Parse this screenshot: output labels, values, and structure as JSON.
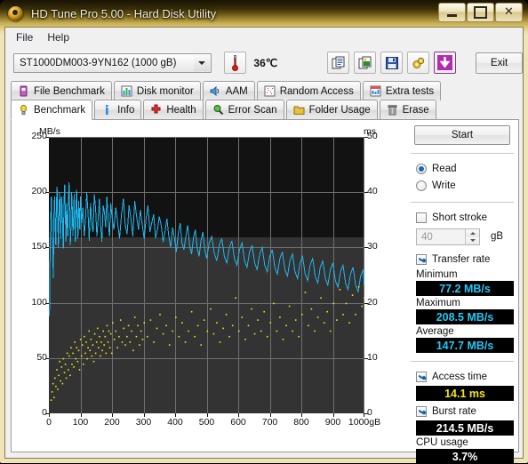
{
  "window": {
    "title": "HD Tune Pro 5.00 - Hard Disk Utility",
    "minimize_label": "",
    "maximize_label": "",
    "close_label": "✕"
  },
  "menu": {
    "items": [
      "File",
      "Help"
    ]
  },
  "toolbar": {
    "drive": "ST1000DM003-9YN162 (1000 gB)",
    "temperature": "36℃",
    "exit_label": "Exit",
    "icons": [
      "copy-text-icon",
      "copy-image-icon",
      "save-icon",
      "settings-icon",
      "download-icon"
    ]
  },
  "tabs": {
    "top_row": [
      {
        "label": "File Benchmark",
        "icon": "file-benchmark-icon"
      },
      {
        "label": "Disk monitor",
        "icon": "disk-monitor-icon"
      },
      {
        "label": "AAM",
        "icon": "aam-speaker-icon"
      },
      {
        "label": "Random Access",
        "icon": "random-access-icon"
      },
      {
        "label": "Extra tests",
        "icon": "extra-tests-icon"
      }
    ],
    "bottom_row": [
      {
        "label": "Benchmark",
        "icon": "benchmark-bulb-icon",
        "selected": true
      },
      {
        "label": "Info",
        "icon": "info-icon",
        "selected": false
      },
      {
        "label": "Health",
        "icon": "health-cross-icon",
        "selected": false
      },
      {
        "label": "Error Scan",
        "icon": "error-scan-magnifier-icon",
        "selected": false
      },
      {
        "label": "Folder Usage",
        "icon": "folder-usage-icon",
        "selected": false
      },
      {
        "label": "Erase",
        "icon": "erase-trash-icon",
        "selected": false
      }
    ]
  },
  "controls": {
    "start_label": "Start",
    "read_label": "Read",
    "read_selected": true,
    "write_label": "Write",
    "write_selected": false,
    "short_stroke_label": "Short stroke",
    "short_stroke_checked": false,
    "short_stroke_value": "40",
    "short_stroke_unit": "gB",
    "transfer_rate_label": "Transfer rate",
    "transfer_rate_checked": true,
    "access_time_label": "Access time",
    "access_time_checked": true,
    "burst_rate_label": "Burst rate",
    "burst_rate_checked": true
  },
  "results": {
    "minimum_label": "Minimum",
    "minimum_value": "77.2 MB/s",
    "maximum_label": "Maximum",
    "maximum_value": "208.5 MB/s",
    "average_label": "Average",
    "average_value": "147.7 MB/s",
    "access_time_value": "14.1 ms",
    "burst_rate_value": "214.5 MB/s",
    "cpu_usage_label": "CPU usage",
    "cpu_usage_value": "3.7%"
  },
  "chart_data": {
    "type": "line",
    "title": "",
    "xlabel": "gB",
    "ylabel": "MB/s",
    "y2label": "ms",
    "xlim": [
      0,
      1000
    ],
    "ylim": [
      0,
      250
    ],
    "y2lim": [
      0,
      50
    ],
    "xticks": [
      0,
      100,
      200,
      300,
      400,
      500,
      600,
      700,
      800,
      900,
      1000
    ],
    "xtick_labels": [
      "0",
      "100",
      "200",
      "300",
      "400",
      "500",
      "600",
      "700",
      "800",
      "900",
      "1000gB"
    ],
    "yticks": [
      0,
      50,
      100,
      150,
      200,
      250
    ],
    "y2ticks": [
      0,
      10,
      20,
      30,
      40,
      50
    ],
    "grid": true,
    "legend": "none",
    "colors": {
      "transfer_rate": "#1fb8f0",
      "access_time": "#f2e60d",
      "background": "#121212",
      "grid": "#6f6f6f"
    },
    "series": [
      {
        "name": "Transfer rate",
        "type": "line",
        "color": "#1fb8f0",
        "unit": "MB/s",
        "axis": "left",
        "x": [
          2,
          4,
          6,
          8,
          10,
          12,
          14,
          16,
          18,
          20,
          22,
          24,
          26,
          28,
          30,
          32,
          34,
          36,
          38,
          40,
          42,
          44,
          46,
          48,
          50,
          52,
          54,
          56,
          58,
          60,
          62,
          64,
          66,
          68,
          70,
          72,
          74,
          76,
          78,
          80,
          82,
          84,
          86,
          88,
          90,
          92,
          94,
          96,
          98,
          100,
          104,
          108,
          112,
          116,
          120,
          124,
          128,
          132,
          136,
          140,
          144,
          148,
          152,
          156,
          160,
          164,
          168,
          172,
          176,
          180,
          184,
          188,
          192,
          196,
          200,
          206,
          212,
          218,
          224,
          230,
          236,
          242,
          248,
          254,
          260,
          266,
          272,
          278,
          284,
          290,
          296,
          302,
          308,
          314,
          320,
          326,
          332,
          338,
          344,
          350,
          356,
          362,
          368,
          374,
          380,
          386,
          392,
          398,
          404,
          410,
          416,
          422,
          428,
          434,
          440,
          446,
          452,
          458,
          464,
          470,
          476,
          482,
          488,
          494,
          500,
          508,
          516,
          524,
          532,
          540,
          548,
          556,
          564,
          572,
          580,
          588,
          596,
          604,
          612,
          620,
          628,
          636,
          644,
          652,
          660,
          668,
          676,
          684,
          692,
          700,
          708,
          716,
          724,
          732,
          740,
          748,
          756,
          764,
          772,
          780,
          788,
          796,
          804,
          812,
          820,
          828,
          836,
          844,
          852,
          860,
          868,
          876,
          884,
          892,
          900,
          908,
          916,
          924,
          932,
          940,
          948,
          956,
          964,
          972,
          980,
          988,
          996,
          1000
        ],
        "values": [
          88,
          150,
          178,
          196,
          160,
          150,
          122,
          180,
          196,
          168,
          152,
          190,
          205,
          175,
          150,
          186,
          200,
          172,
          158,
          196,
          188,
          162,
          149,
          192,
          207,
          180,
          155,
          190,
          170,
          160,
          196,
          209,
          182,
          152,
          168,
          200,
          186,
          160,
          175,
          198,
          170,
          155,
          188,
          202,
          175,
          158,
          192,
          180,
          166,
          196,
          172,
          186,
          160,
          175,
          200,
          182,
          156,
          190,
          172,
          164,
          198,
          186,
          160,
          176,
          194,
          170,
          155,
          188,
          182,
          168,
          196,
          174,
          160,
          190,
          178,
          166,
          186,
          172,
          158,
          180,
          194,
          170,
          162,
          188,
          176,
          160,
          192,
          178,
          166,
          184,
          170,
          158,
          176,
          188,
          164,
          172,
          180,
          158,
          166,
          178,
          170,
          155,
          164,
          176,
          160,
          150,
          168,
          158,
          146,
          162,
          172,
          154,
          148,
          160,
          170,
          152,
          144,
          158,
          166,
          150,
          142,
          156,
          164,
          148,
          140,
          154,
          160,
          145,
          138,
          152,
          158,
          142,
          136,
          150,
          156,
          140,
          134,
          148,
          154,
          138,
          132,
          146,
          152,
          136,
          130,
          144,
          150,
          134,
          128,
          142,
          148,
          132,
          126,
          140,
          146,
          130,
          124,
          138,
          144,
          128,
          122,
          136,
          142,
          126,
          120,
          134,
          140,
          124,
          118,
          132,
          138,
          122,
          116,
          130,
          136,
          120,
          114,
          128,
          134,
          118,
          112,
          126,
          132,
          116,
          110,
          124,
          130,
          114,
          108,
          122,
          128,
          112,
          106,
          120,
          126,
          110,
          104,
          118,
          96
        ]
      },
      {
        "name": "Access time",
        "type": "scatter",
        "color": "#f2e60d",
        "unit": "ms",
        "axis": "right",
        "points": [
          [
            5,
            2.5
          ],
          [
            8,
            4
          ],
          [
            11,
            5.5
          ],
          [
            14,
            3
          ],
          [
            17,
            6.5
          ],
          [
            20,
            5
          ],
          [
            23,
            8
          ],
          [
            26,
            4.5
          ],
          [
            29,
            7
          ],
          [
            32,
            9.5
          ],
          [
            35,
            6
          ],
          [
            38,
            8.5
          ],
          [
            41,
            5.5
          ],
          [
            44,
            10
          ],
          [
            47,
            7.5
          ],
          [
            50,
            9
          ],
          [
            53,
            6.5
          ],
          [
            56,
            11
          ],
          [
            59,
            8
          ],
          [
            62,
            10.5
          ],
          [
            65,
            7
          ],
          [
            68,
            12
          ],
          [
            71,
            9
          ],
          [
            74,
            11
          ],
          [
            77,
            8.5
          ],
          [
            80,
            13
          ],
          [
            83,
            10
          ],
          [
            86,
            12
          ],
          [
            89,
            9.5
          ],
          [
            92,
            11.5
          ],
          [
            95,
            8
          ],
          [
            98,
            13.5
          ],
          [
            101,
            10.5
          ],
          [
            104,
            12.5
          ],
          [
            107,
            9
          ],
          [
            110,
            14
          ],
          [
            113,
            11
          ],
          [
            116,
            13
          ],
          [
            119,
            10
          ],
          [
            122,
            12
          ],
          [
            125,
            15
          ],
          [
            128,
            11.5
          ],
          [
            131,
            13.5
          ],
          [
            134,
            10.5
          ],
          [
            137,
            12.5
          ],
          [
            140,
            9.5
          ],
          [
            143,
            14.5
          ],
          [
            146,
            11
          ],
          [
            149,
            13
          ],
          [
            152,
            15.5
          ],
          [
            155,
            12
          ],
          [
            158,
            14
          ],
          [
            161,
            10.5
          ],
          [
            164,
            13
          ],
          [
            167,
            11.5
          ],
          [
            170,
            15
          ],
          [
            173,
            12.5
          ],
          [
            176,
            14
          ],
          [
            179,
            11
          ],
          [
            182,
            16
          ],
          [
            185,
            13
          ],
          [
            188,
            15
          ],
          [
            191,
            12
          ],
          [
            194,
            14.5
          ],
          [
            197,
            11
          ],
          [
            200,
            16.5
          ],
          [
            205,
            13.5
          ],
          [
            210,
            15
          ],
          [
            215,
            12
          ],
          [
            220,
            14
          ],
          [
            225,
            17
          ],
          [
            230,
            13
          ],
          [
            235,
            15.5
          ],
          [
            240,
            12.5
          ],
          [
            245,
            14
          ],
          [
            250,
            16
          ],
          [
            255,
            13
          ],
          [
            260,
            15
          ],
          [
            265,
            11.5
          ],
          [
            270,
            17.5
          ],
          [
            275,
            14
          ],
          [
            280,
            16
          ],
          [
            285,
            12.5
          ],
          [
            290,
            15
          ],
          [
            295,
            13.5
          ],
          [
            300,
            16.5
          ],
          [
            310,
            14
          ],
          [
            320,
            17
          ],
          [
            330,
            13
          ],
          [
            340,
            15.5
          ],
          [
            350,
            18
          ],
          [
            360,
            14.5
          ],
          [
            370,
            16
          ],
          [
            380,
            12.5
          ],
          [
            390,
            15
          ],
          [
            400,
            17.5
          ],
          [
            410,
            14
          ],
          [
            420,
            16.5
          ],
          [
            430,
            13
          ],
          [
            440,
            15
          ],
          [
            450,
            18.5
          ],
          [
            460,
            14
          ],
          [
            470,
            16
          ],
          [
            480,
            12.5
          ],
          [
            490,
            17
          ],
          [
            500,
            15
          ],
          [
            510,
            19
          ],
          [
            520,
            14.5
          ],
          [
            530,
            16.5
          ],
          [
            540,
            13
          ],
          [
            550,
            15.5
          ],
          [
            560,
            18
          ],
          [
            570,
            14
          ],
          [
            580,
            16
          ],
          [
            590,
            21
          ],
          [
            600,
            15
          ],
          [
            610,
            17.5
          ],
          [
            620,
            13.5
          ],
          [
            630,
            16
          ],
          [
            640,
            19
          ],
          [
            650,
            14.5
          ],
          [
            660,
            17
          ],
          [
            670,
            15
          ],
          [
            680,
            18.5
          ],
          [
            690,
            14
          ],
          [
            700,
            16.5
          ],
          [
            710,
            20
          ],
          [
            720,
            15
          ],
          [
            730,
            17.5
          ],
          [
            740,
            13.5
          ],
          [
            750,
            16
          ],
          [
            760,
            19.5
          ],
          [
            770,
            15
          ],
          [
            780,
            17
          ],
          [
            790,
            14
          ],
          [
            800,
            18
          ],
          [
            810,
            22
          ],
          [
            820,
            16
          ],
          [
            830,
            19
          ],
          [
            840,
            15
          ],
          [
            850,
            17.5
          ],
          [
            860,
            21
          ],
          [
            870,
            16.5
          ],
          [
            880,
            18.5
          ],
          [
            890,
            15
          ],
          [
            900,
            20
          ],
          [
            910,
            17
          ],
          [
            920,
            22.5
          ],
          [
            930,
            18
          ],
          [
            940,
            20
          ],
          [
            950,
            16.5
          ],
          [
            960,
            21.5
          ],
          [
            970,
            18
          ],
          [
            980,
            23
          ],
          [
            990,
            19.5
          ],
          [
            998,
            21
          ]
        ]
      }
    ]
  }
}
